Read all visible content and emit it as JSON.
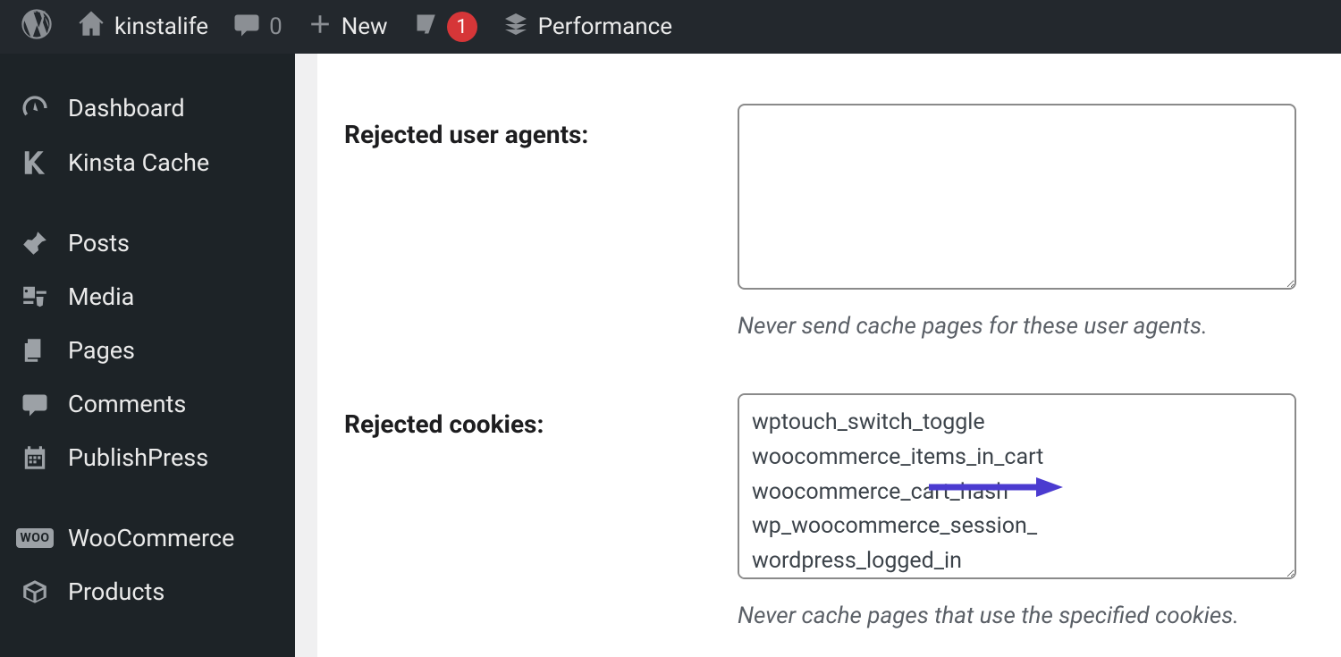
{
  "toolbar": {
    "site_name": "kinstalife",
    "comments_count": "0",
    "new_label": "New",
    "yoast_badge": "1",
    "performance_label": "Performance"
  },
  "sidebar": {
    "items": [
      {
        "label": "Dashboard"
      },
      {
        "label": "Kinsta Cache"
      },
      {
        "label": "Posts"
      },
      {
        "label": "Media"
      },
      {
        "label": "Pages"
      },
      {
        "label": "Comments"
      },
      {
        "label": "PublishPress"
      },
      {
        "label": "WooCommerce"
      },
      {
        "label": "Products"
      }
    ],
    "woo_badge": "WOO"
  },
  "settings": {
    "rejected_user_agents": {
      "label": "Rejected user agents:",
      "value": "",
      "helper": "Never send cache pages for these user agents."
    },
    "rejected_cookies": {
      "label": "Rejected cookies:",
      "value": "wptouch_switch_toggle\nwoocommerce_items_in_cart\nwoocommerce_cart_hash\nwp_woocommerce_session_\nwordpress_logged_in",
      "helper": "Never cache pages that use the specified cookies."
    }
  },
  "colors": {
    "arrow": "#4b3bd0"
  }
}
